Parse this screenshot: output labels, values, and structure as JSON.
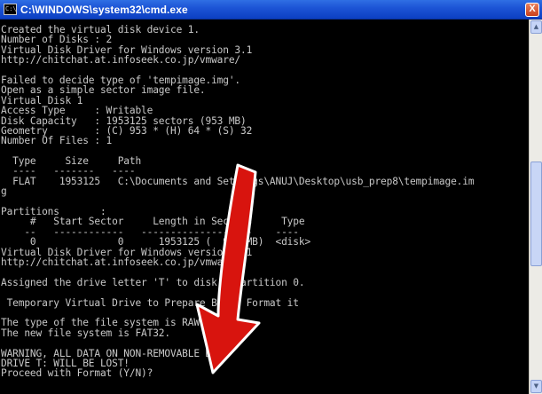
{
  "window": {
    "title": "C:\\WINDOWS\\system32\\cmd.exe",
    "icon": "cmd-icon",
    "icon_text": "C:\\",
    "close_label": "X"
  },
  "console": {
    "lines": [
      "Created the virtual disk device 1.",
      "Number of Disks : 2",
      "Virtual Disk Driver for Windows version 3.1",
      "http://chitchat.at.infoseek.co.jp/vmware/",
      "",
      "Failed to decide type of 'tempimage.img'.",
      "Open as a simple sector image file.",
      "Virtual Disk 1",
      "Access Type     : Writable",
      "Disk Capacity   : 1953125 sectors (953 MB)",
      "Geometry        : (C) 953 * (H) 64 * (S) 32",
      "Number Of Files : 1",
      "",
      "  Type     Size     Path",
      "  ----   -------   ----",
      "  FLAT    1953125   C:\\Documents and Settings\\ANUJ\\Desktop\\usb_prep8\\tempimage.im",
      "g",
      "",
      "Partitions       :",
      "     #   Start Sector     Length in Sectors     Type",
      "    --   ------------   -------------------    ----",
      "     0              0      1953125 (  953 MB)  <disk>",
      "Virtual Disk Driver for Windows version 3.1",
      "http://chitchat.at.infoseek.co.jp/vmware/",
      "",
      "Assigned the drive letter 'T' to disk 1 partition 0.",
      "",
      " Temporary Virtual Drive to Prepare Boots Format it",
      "",
      "The type of the file system is RAW.",
      "The new file system is FAT32.",
      "",
      "WARNING, ALL DATA ON NON-REMOVABLE DISK",
      "DRIVE T: WILL BE LOST!",
      "Proceed with Format (Y/N)?"
    ]
  },
  "scrollbar": {
    "up_icon": "scroll-up-arrow-icon",
    "down_icon": "scroll-down-arrow-icon",
    "up_glyph": "▲",
    "down_glyph": "▼"
  },
  "annotation": {
    "icon": "red-arrow-icon",
    "color": "#d8140e"
  }
}
